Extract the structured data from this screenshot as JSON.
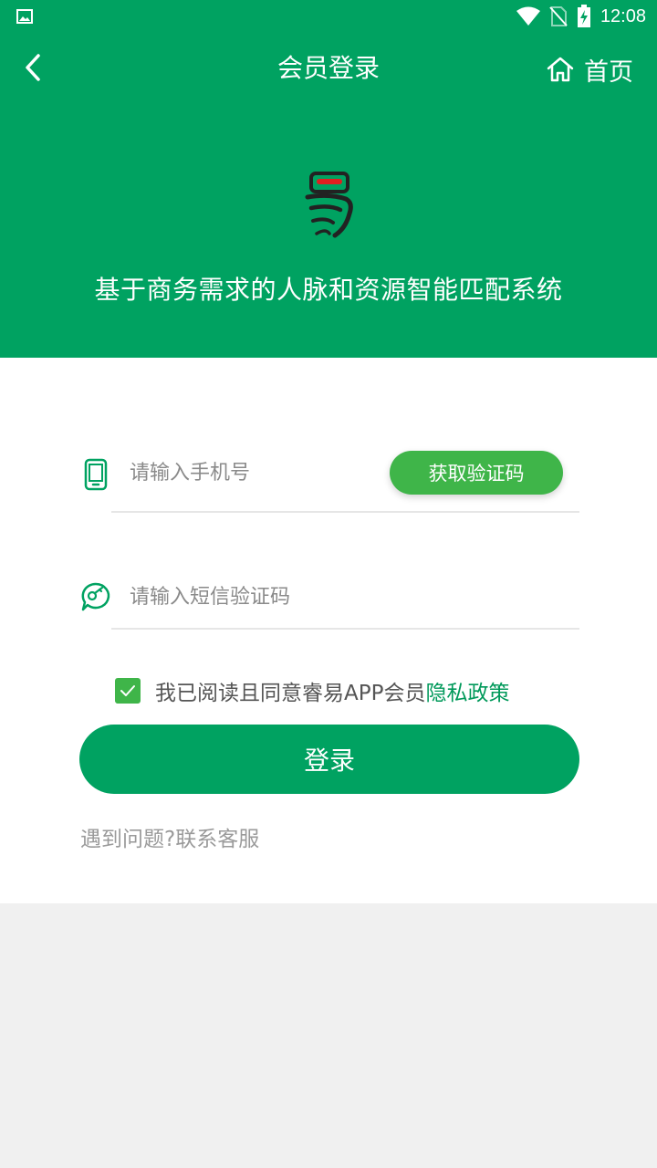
{
  "status_bar": {
    "time": "12:08",
    "icons": [
      "gallery-icon",
      "wifi-icon",
      "no-sim-icon",
      "battery-charging-icon"
    ]
  },
  "header": {
    "title": "会员登录",
    "home_label": "首页",
    "slogan": "基于商务需求的人脉和资源智能匹配系统"
  },
  "form": {
    "phone_placeholder": "请输入手机号",
    "get_code_label": "获取验证码",
    "sms_placeholder": "请输入短信验证码",
    "agree_text": "我已阅读且同意睿易APP会员",
    "policy_link": "隐私政策",
    "agree_checked": true,
    "login_label": "登录",
    "help_link": "遇到问题?联系客服"
  },
  "colors": {
    "brand": "#00a261",
    "button_green": "#3fb549",
    "link": "#00995a"
  }
}
